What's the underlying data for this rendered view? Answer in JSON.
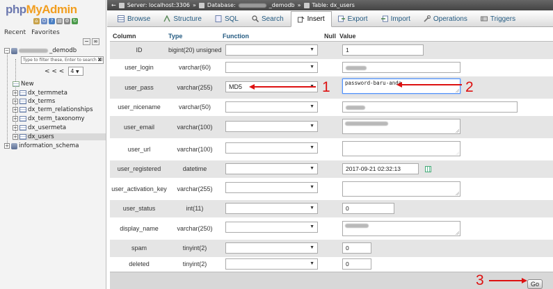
{
  "app": {
    "logo_php": "php",
    "logo_myadmin": "MyAdmin"
  },
  "nav": {
    "tabs": [
      "Recent",
      "Favorites"
    ],
    "db_name_suffix": "_demodb",
    "filter_placeholder": "Type to filter these, Enter to search all",
    "filter_clear": "X",
    "pager_prev": "< < <",
    "pager_value": "4",
    "tables": [
      {
        "label": "New"
      },
      {
        "label": "dx_termmeta"
      },
      {
        "label": "dx_terms"
      },
      {
        "label": "dx_term_relationships"
      },
      {
        "label": "dx_term_taxonomy"
      },
      {
        "label": "dx_usermeta"
      },
      {
        "label": "dx_users"
      }
    ],
    "other_db": "information_schema"
  },
  "breadcrumb": {
    "server": "Server: localhost:3306",
    "database_label": "Database:",
    "database_suffix": "_demodb",
    "table": "Table: dx_users",
    "sep": "»"
  },
  "menu": {
    "tabs": [
      {
        "label": "Browse",
        "icon": "browse-icon"
      },
      {
        "label": "Structure",
        "icon": "structure-icon"
      },
      {
        "label": "SQL",
        "icon": "sql-icon"
      },
      {
        "label": "Search",
        "icon": "search-icon"
      },
      {
        "label": "Insert",
        "icon": "insert-icon",
        "active": true
      },
      {
        "label": "Export",
        "icon": "export-icon"
      },
      {
        "label": "Import",
        "icon": "import-icon"
      },
      {
        "label": "Operations",
        "icon": "operations-icon"
      },
      {
        "label": "Triggers",
        "icon": "triggers-icon"
      }
    ]
  },
  "table_header": {
    "column": "Column",
    "type": "Type",
    "function": "Function",
    "null": "Null",
    "value": "Value"
  },
  "rows": [
    {
      "name": "ID",
      "type": "bigint(20) unsigned",
      "function": "",
      "value": "1",
      "value_kind": "input"
    },
    {
      "name": "user_login",
      "type": "varchar(60)",
      "function": "",
      "value": "",
      "value_kind": "input",
      "blurred": true
    },
    {
      "name": "user_pass",
      "type": "varchar(255)",
      "function": "MD5",
      "value": "password-baru-anda",
      "value_kind": "textarea"
    },
    {
      "name": "user_nicename",
      "type": "varchar(50)",
      "function": "",
      "value": "",
      "value_kind": "input",
      "blurred": true
    },
    {
      "name": "user_email",
      "type": "varchar(100)",
      "function": "",
      "value": "",
      "value_kind": "textarea",
      "blurred": true
    },
    {
      "name": "user_url",
      "type": "varchar(100)",
      "function": "",
      "value": "",
      "value_kind": "textarea"
    },
    {
      "name": "user_registered",
      "type": "datetime",
      "function": "",
      "value": "2017-09-21 02:32:13",
      "value_kind": "input"
    },
    {
      "name": "user_activation_key",
      "type": "varchar(255)",
      "function": "",
      "value": "",
      "value_kind": "textarea"
    },
    {
      "name": "user_status",
      "type": "int(11)",
      "function": "",
      "value": "0",
      "value_kind": "input"
    },
    {
      "name": "display_name",
      "type": "varchar(250)",
      "function": "",
      "value": "",
      "value_kind": "textarea",
      "blurred": true
    },
    {
      "name": "spam",
      "type": "tinyint(2)",
      "function": "",
      "value": "0",
      "value_kind": "input"
    },
    {
      "name": "deleted",
      "type": "tinyint(2)",
      "function": "",
      "value": "0",
      "value_kind": "input"
    }
  ],
  "go_button": "Go",
  "annotations": {
    "labels": [
      "1",
      "2",
      "3"
    ],
    "color": "#dd1111"
  },
  "colors": {
    "link_blue": "#235a81",
    "logo_blue": "#6c78af",
    "logo_orange": "#f29e1f",
    "row_alt": "#e5e5e5"
  }
}
